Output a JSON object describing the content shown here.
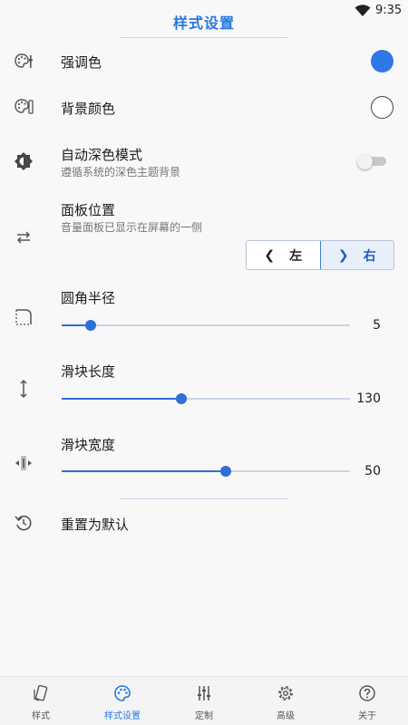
{
  "status": {
    "time": "9:35"
  },
  "page": {
    "title": "样式设置"
  },
  "rows": {
    "accent": {
      "title": "强调色",
      "color": "#2d79e6"
    },
    "background": {
      "title": "背景颜色",
      "color": "#ffffff"
    },
    "dark_mode": {
      "title": "自动深色模式",
      "subtitle": "遵循系统的深色主题背景",
      "enabled": false
    },
    "panel_position": {
      "title": "面板位置",
      "subtitle": "音量面板已显示在屏幕的一侧",
      "left_label": "左",
      "right_label": "右",
      "selected": "右"
    },
    "corner_radius": {
      "title": "圆角半径",
      "value": 5,
      "fraction": 0.1
    },
    "slider_length": {
      "title": "滑块长度",
      "value": 130,
      "fraction": 0.415
    },
    "slider_width": {
      "title": "滑块宽度",
      "value": 50,
      "fraction": 0.57
    },
    "reset": {
      "title": "重置为默认"
    }
  },
  "nav": {
    "items": [
      {
        "label": "样式",
        "icon": "phone-style-icon"
      },
      {
        "label": "样式设置",
        "icon": "palette-icon",
        "active": true
      },
      {
        "label": "定制",
        "icon": "sliders-icon"
      },
      {
        "label": "高级",
        "icon": "gear-icon"
      },
      {
        "label": "关于",
        "icon": "help-icon"
      }
    ]
  },
  "colors": {
    "accent": "#2778de",
    "slider": "#2f6fd6"
  }
}
